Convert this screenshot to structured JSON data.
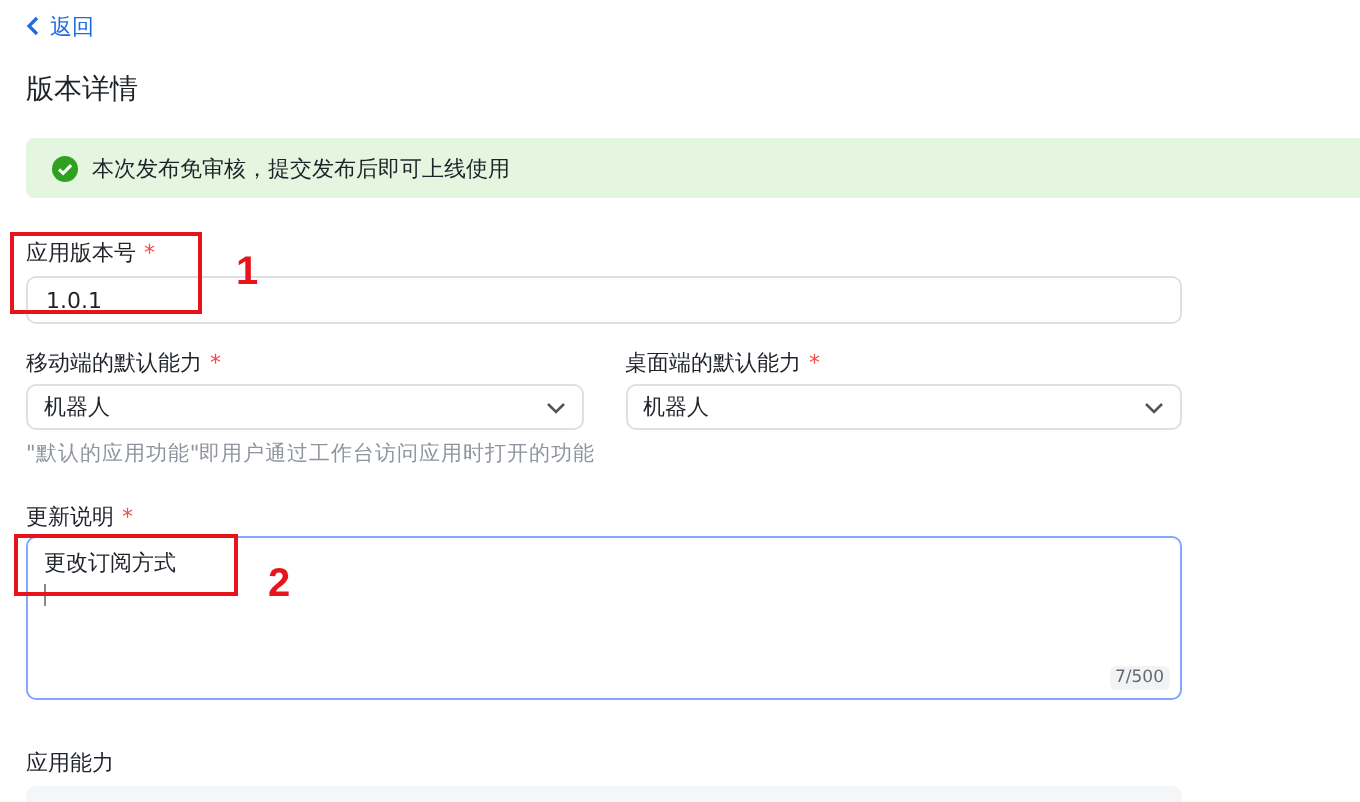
{
  "back_link": {
    "label": "返回"
  },
  "title": "版本详情",
  "notice": {
    "text": "本次发布免审核，提交发布后即可上线使用"
  },
  "version_field": {
    "label": "应用版本号",
    "required_mark": "*",
    "value": "1.0.1"
  },
  "selects": [
    {
      "label": "移动端的默认能力",
      "required_mark": "*",
      "value": "机器人"
    },
    {
      "label": "桌面端的默认能力",
      "required_mark": "*",
      "value": "机器人"
    }
  ],
  "select_hint": "\"默认的应用功能\"即用户通过工作台访问应用时打开的功能",
  "update_notes": {
    "label": "更新说明",
    "required_mark": "*",
    "value": "更改订阅方式",
    "counter": "7/500",
    "focused": true
  },
  "capabilities": {
    "label": "应用能力"
  },
  "annotations": [
    {
      "number": "1"
    },
    {
      "number": "2"
    }
  ]
}
